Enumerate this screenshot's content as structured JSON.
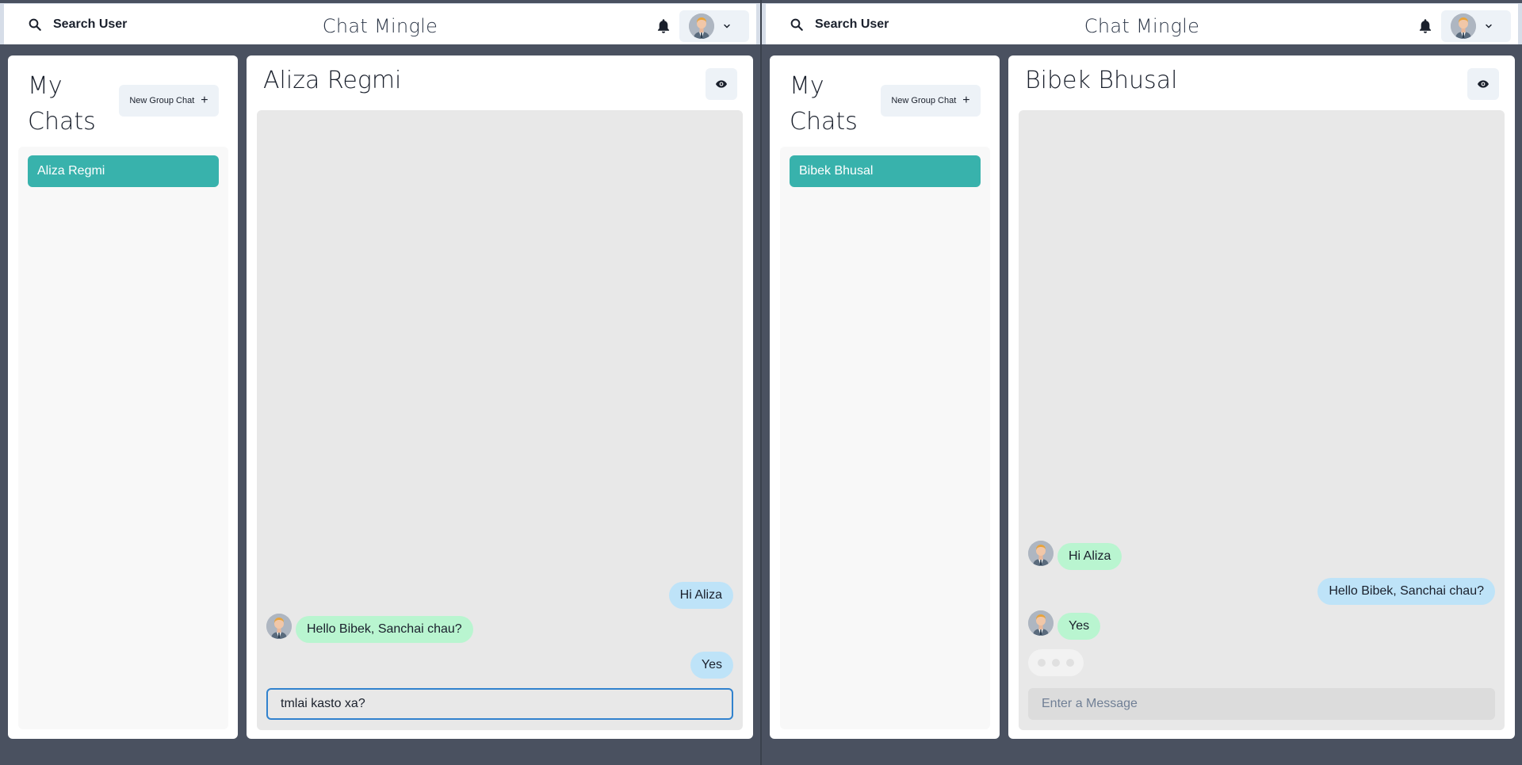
{
  "left": {
    "header": {
      "search_label": "Search User",
      "app_title": "Chat Mingle"
    },
    "sidebar": {
      "title": "My Chats",
      "new_group_label": "New Group Chat",
      "chats": [
        {
          "label": "Aliza Regmi"
        }
      ]
    },
    "conversation": {
      "title": "Aliza Regmi",
      "messages": [
        {
          "text": "Hi Aliza",
          "direction": "sent"
        },
        {
          "text": "Hello Bibek, Sanchai chau?",
          "direction": "received"
        },
        {
          "text": "Yes",
          "direction": "sent"
        }
      ],
      "input": {
        "value": "tmlai kasto xa?",
        "placeholder": "Enter a Message"
      }
    }
  },
  "right": {
    "header": {
      "search_label": "Search User",
      "app_title": "Chat Mingle"
    },
    "sidebar": {
      "title": "My Chats",
      "new_group_label": "New Group Chat",
      "chats": [
        {
          "label": "Bibek Bhusal"
        }
      ]
    },
    "conversation": {
      "title": "Bibek Bhusal",
      "messages": [
        {
          "text": "Hi Aliza",
          "direction": "received"
        },
        {
          "text": "Hello Bibek, Sanchai chau?",
          "direction": "sent"
        },
        {
          "text": "Yes",
          "direction": "received"
        }
      ],
      "typing_indicator": true,
      "input": {
        "value": "",
        "placeholder": "Enter a Message"
      }
    }
  },
  "colors": {
    "accent": "#38b2ac",
    "sent_bubble": "#bee3f8",
    "received_bubble": "#b9f5d0",
    "background": "#4a5160"
  },
  "icons": [
    "search-icon",
    "bell-icon",
    "avatar",
    "chevron-down-icon",
    "plus-icon",
    "eye-icon"
  ]
}
